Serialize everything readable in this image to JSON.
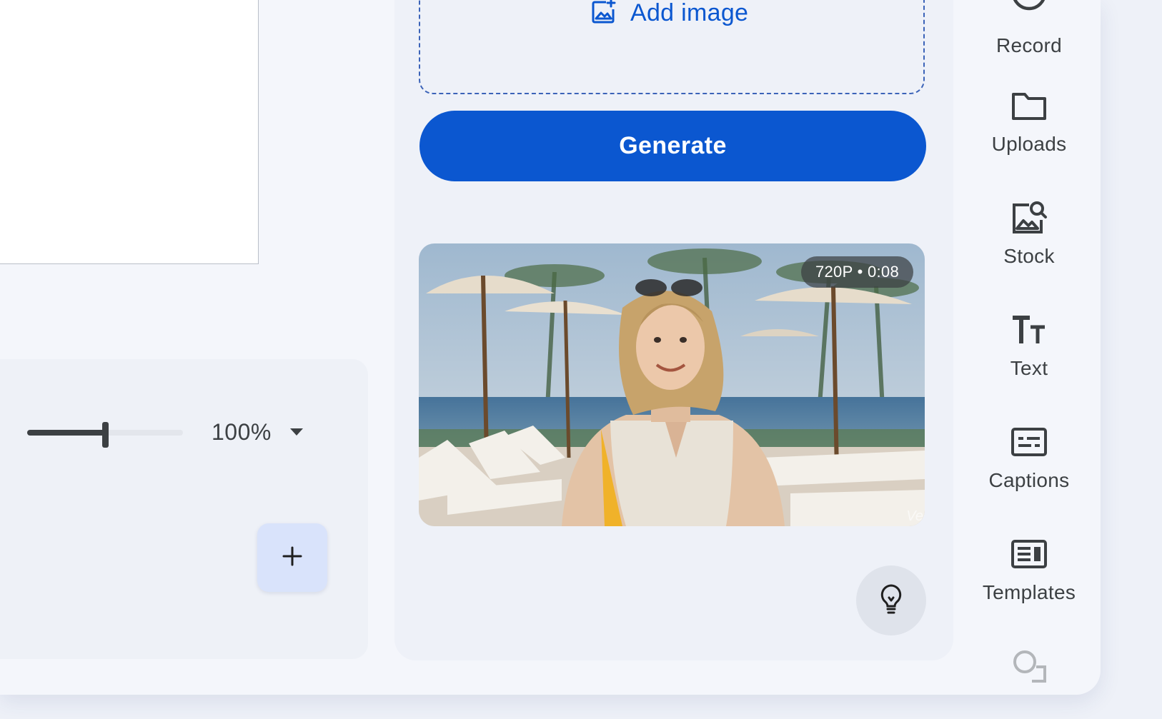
{
  "left": {
    "zoom": {
      "level_fraction": 0.5,
      "value_label": "100%"
    },
    "add_scene_symbol": "+"
  },
  "generate_panel": {
    "add_image_label": "Add image",
    "generate_label": "Generate",
    "video": {
      "meta": "720P • 0:08",
      "watermark": "Ve"
    }
  },
  "rail": {
    "items": [
      {
        "label": "Record",
        "icon": "record-icon"
      },
      {
        "label": "Uploads",
        "icon": "folder-icon"
      },
      {
        "label": "Stock",
        "icon": "stock-image-search-icon"
      },
      {
        "label": "Text",
        "icon": "text-icon"
      },
      {
        "label": "Captions",
        "icon": "captions-icon"
      },
      {
        "label": "Templates",
        "icon": "templates-icon"
      },
      {
        "label": "",
        "icon": "shapes-icon"
      }
    ]
  },
  "colors": {
    "accent": "#0b57d0",
    "panel": "#eef1f8",
    "text": "#3c4043"
  }
}
